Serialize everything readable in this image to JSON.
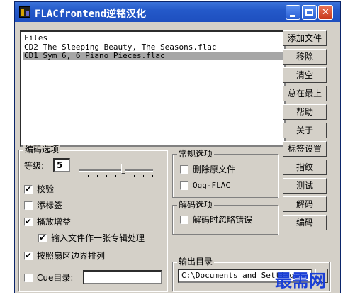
{
  "window": {
    "title": "FLACfrontend逆铭汉化"
  },
  "file_list": {
    "header": "Files",
    "items": [
      {
        "text": "CD2 The Sleeping Beauty, The Seasons.flac",
        "selected": false
      },
      {
        "text": "CD1 Sym 6, 6 Piano Pieces.flac",
        "selected": true
      }
    ]
  },
  "side_buttons": [
    "添加文件",
    "移除",
    "清空",
    "总在最上",
    "帮助",
    "关于",
    "标签设置",
    "指纹",
    "测试",
    "解码",
    "编码"
  ],
  "encode_options": {
    "label": "编码选项",
    "level_label": "等级:",
    "level_value": "5",
    "level_slider_fraction": 0.6,
    "verify_label": "校验",
    "verify_checked": true,
    "add_tag_label": "添标签",
    "add_tag_checked": false,
    "replay_gain_label": "播放增益",
    "replay_gain_checked": true,
    "album_mode_label": "输入文件作一张专辑处理",
    "album_mode_checked": true,
    "sector_align_label": "按照扇区边界排列",
    "sector_align_checked": true,
    "cue_label": "Cue目录:",
    "cue_checked": false,
    "cue_value": ""
  },
  "general_options": {
    "label": "常规选项",
    "delete_original_label": "删除原文件",
    "delete_original_checked": false,
    "ogg_flac_label": "Ogg-FLAC",
    "ogg_flac_checked": false
  },
  "decode_options": {
    "label": "解码选项",
    "ignore_errors_label": "解码时忽略错误",
    "ignore_errors_checked": false
  },
  "output_dir": {
    "label": "输出目录",
    "value": "C:\\Documents and Settings"
  },
  "watermark": "最需网",
  "check_mark": "✔"
}
